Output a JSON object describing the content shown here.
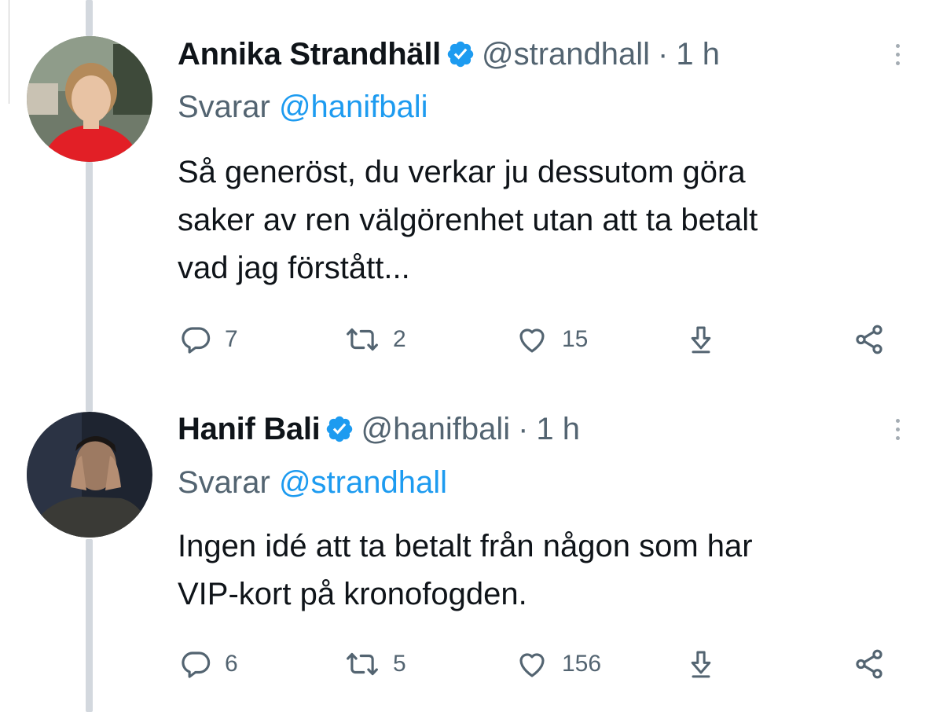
{
  "tweets": [
    {
      "author_name": "Annika Strandhäll",
      "handle": "@strandhall",
      "separator": "·",
      "time": "1 h",
      "replying_prefix": "Svarar",
      "replying_to": "@hanifbali",
      "body_lines": [
        "Så generöst, du verkar ju dessutom göra",
        "saker av ren välgörenhet utan att ta betalt",
        "vad jag förstått..."
      ],
      "counts": {
        "replies": "7",
        "retweets": "2",
        "likes": "15"
      }
    },
    {
      "author_name": "Hanif Bali",
      "handle": "@hanifbali",
      "separator": "·",
      "time": "1 h",
      "replying_prefix": "Svarar",
      "replying_to": "@strandhall",
      "body_lines": [
        "Ingen idé att ta betalt från någon som har",
        "VIP-kort på kronofogden."
      ],
      "counts": {
        "replies": "6",
        "retweets": "5",
        "likes": "156"
      }
    }
  ],
  "icons": {
    "verified": "verified-badge-icon",
    "more": "more-vertical-icon",
    "reply": "reply-bubble-icon",
    "retweet": "retweet-icon",
    "like": "heart-icon",
    "download": "download-arrow-icon",
    "share": "share-icon"
  },
  "colors": {
    "verified_blue": "#1d9bf0",
    "mention_blue": "#1d9bf0",
    "secondary_text": "#536471",
    "primary_text": "#0f1419",
    "thread_line": "#d3d8de"
  }
}
